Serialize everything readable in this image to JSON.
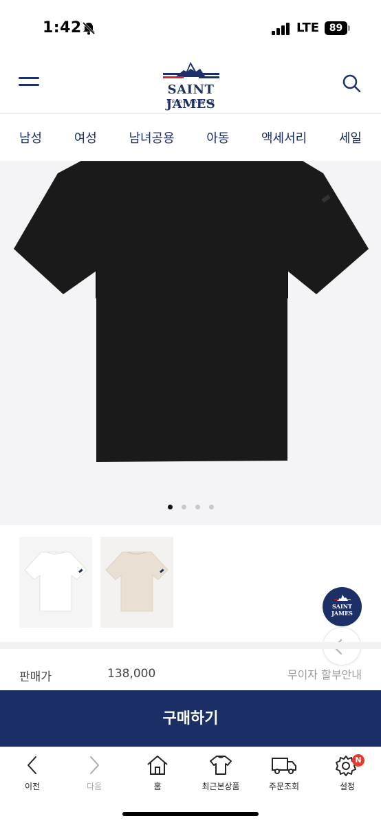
{
  "status_bar": {
    "time": "1:42",
    "network": "LTE",
    "battery": "89"
  },
  "header": {
    "logo": {
      "name": "SAINT JAMES",
      "tagline": "NÉ DE LA MER"
    }
  },
  "categories": [
    "남성",
    "여성",
    "남녀공용",
    "아동",
    "액세서리",
    "세일"
  ],
  "product": {
    "main_color": "#1a1a1a",
    "carousel_total": 4,
    "carousel_active": 1,
    "color_options": [
      {
        "color": "#ffffff"
      },
      {
        "color": "#e9dfd2"
      }
    ]
  },
  "floating": {
    "brand_label": "SAINT JAMES"
  },
  "price": {
    "label": "판매가",
    "value": "138,000",
    "installment": "무이자 할부안내"
  },
  "buy_button": {
    "label": "구매하기"
  },
  "toolbar": {
    "items": [
      {
        "label": "이전",
        "icon": "chevron-left-icon"
      },
      {
        "label": "다음",
        "icon": "chevron-right-icon"
      },
      {
        "label": "홈",
        "icon": "home-icon"
      },
      {
        "label": "최근본상품",
        "icon": "tshirt-icon"
      },
      {
        "label": "주문조회",
        "icon": "truck-icon"
      },
      {
        "label": "설정",
        "icon": "gear-icon"
      }
    ],
    "badge": "N"
  },
  "colors": {
    "brand_navy": "#1b2f66",
    "badge_red": "#e8392b"
  }
}
